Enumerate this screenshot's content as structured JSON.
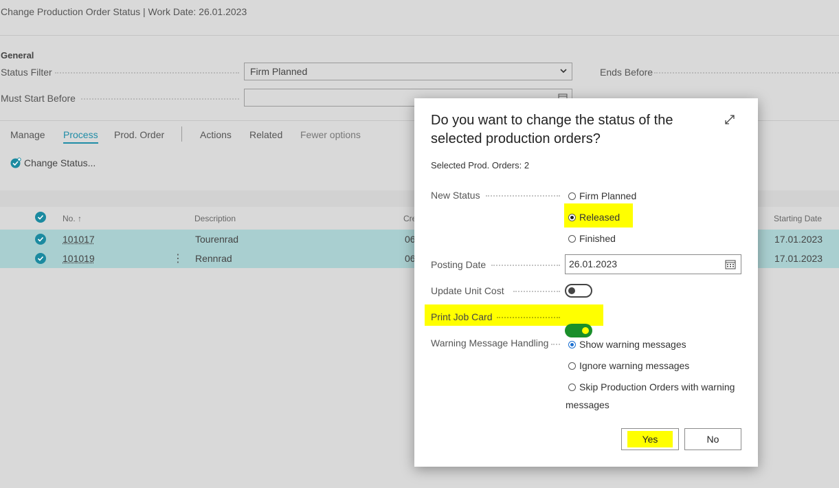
{
  "page": {
    "title": "Change Production Order Status | Work Date: 26.01.2023",
    "section_general": "General"
  },
  "filters": {
    "status_filter_label": "Status Filter",
    "status_filter_value": "Firm Planned",
    "must_start_before_label": "Must Start Before",
    "must_start_before_value": "",
    "ends_before_label": "Ends Before"
  },
  "menu": {
    "items": [
      "Manage",
      "Process",
      "Prod. Order",
      "Actions",
      "Related",
      "Fewer options"
    ],
    "active": "Process",
    "sub_action": "Change Status..."
  },
  "grid": {
    "columns": {
      "no": "No. ↑",
      "description": "Description",
      "created_partial": "Cre",
      "starting_date": "Starting Date"
    },
    "rows": [
      {
        "no": "101017",
        "description": "Tourenrad",
        "created_partial": "06",
        "starting_date": "17.01.2023"
      },
      {
        "no": "101019",
        "description": "Rennrad",
        "created_partial": "06",
        "starting_date": "17.01.2023"
      }
    ],
    "row_menu_glyph": "⋮"
  },
  "dialog": {
    "title": "Do you want to change the status of the selected production orders?",
    "selected_text": "Selected Prod. Orders: 2",
    "new_status_label": "New Status",
    "status_options": [
      "Firm Planned",
      "Released",
      "Finished"
    ],
    "selected_status": "Released",
    "posting_date_label": "Posting Date",
    "posting_date_value": "26.01.2023",
    "update_unit_cost_label": "Update Unit Cost",
    "update_unit_cost_on": false,
    "print_job_card_label": "Print Job Card",
    "print_job_card_on": true,
    "warning_label": "Warning Message Handling",
    "warning_options": [
      "Show warning messages",
      "Ignore warning messages",
      "Skip Production Orders with warning"
    ],
    "warning_option_3_cont": "messages",
    "selected_warning": "Show warning messages",
    "yes_label": "Yes",
    "no_label": "No"
  },
  "colors": {
    "accent": "#1e8ca6",
    "highlight": "#ffff00",
    "selected_row": "#a9cfd0",
    "toggle_on": "#1a8f2a"
  }
}
